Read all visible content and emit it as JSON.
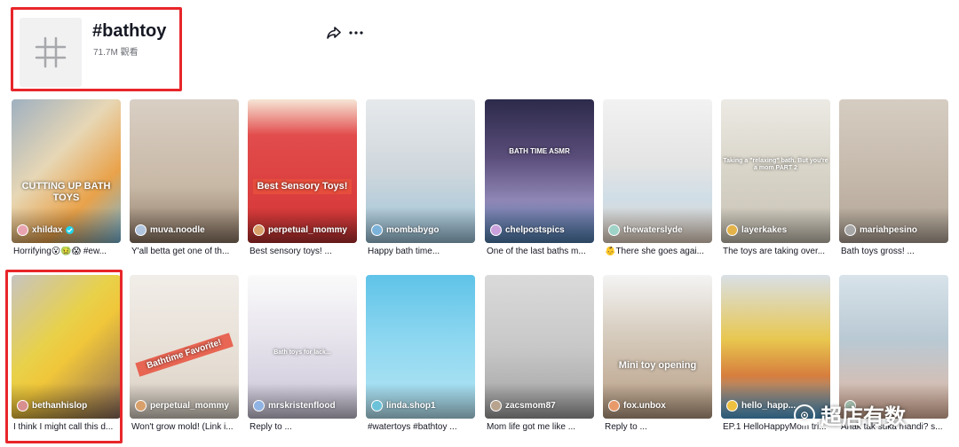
{
  "header": {
    "tag_title": "#bathtoy",
    "views": "71.7M 觀看"
  },
  "videos": [
    {
      "author": "xhildax",
      "verified": true,
      "caption": "Horrifying😮🤢😱 #ew...",
      "overlay": "CUTTING UP BATH TOYS"
    },
    {
      "author": "muva.noodle",
      "verified": false,
      "caption": "Y'all betta get one of th...",
      "overlay": ""
    },
    {
      "author": "perpetual_mommy",
      "verified": false,
      "caption": "Best sensory toys! ...",
      "overlay": "Best Sensory Toys!"
    },
    {
      "author": "mombabygo",
      "verified": false,
      "caption": "Happy bath time...",
      "overlay": ""
    },
    {
      "author": "chelpostspics",
      "verified": false,
      "caption": "One of the last baths m...",
      "overlay": "BATH TIME ASMR"
    },
    {
      "author": "thewaterslyde",
      "verified": false,
      "caption": "👶There she goes agai...",
      "overlay": ""
    },
    {
      "author": "layerkakes",
      "verified": false,
      "caption": "The toys are taking over...",
      "overlay": "Taking a \"relaxing\" bath. But you're a mom PART 2"
    },
    {
      "author": "mariahpesino",
      "verified": false,
      "caption": "Bath toys gross! ...",
      "overlay": ""
    },
    {
      "author": "bethanhislop",
      "verified": false,
      "caption": "I think I might call this d...",
      "overlay": ""
    },
    {
      "author": "perpetual_mommy",
      "verified": false,
      "caption": "Won't grow mold! (Link i...",
      "overlay": "Bathtime Favorite!"
    },
    {
      "author": "mrskristenflood",
      "verified": false,
      "caption": "Reply to ...",
      "overlay": "Bath toys for lack..."
    },
    {
      "author": "linda.shop1",
      "verified": false,
      "caption": "#watertoys #bathtoy ...",
      "overlay": ""
    },
    {
      "author": "zacsmom87",
      "verified": false,
      "caption": "Mom life got me like ...",
      "overlay": ""
    },
    {
      "author": "fox.unbox",
      "verified": false,
      "caption": "Reply to ...",
      "overlay": "Mini toy opening"
    },
    {
      "author": "hello_happ...",
      "verified": false,
      "caption": "EP.1 HelloHappyMom tri...",
      "overlay": ""
    },
    {
      "author": "",
      "verified": false,
      "caption": "Anak tak suka mandi? s...",
      "overlay": ""
    }
  ],
  "watermark": "超店有数",
  "colors": {
    "highlight": "#e8262a",
    "verified": "#20d5ec",
    "text": "#161823",
    "muted": "#6b6e74"
  }
}
